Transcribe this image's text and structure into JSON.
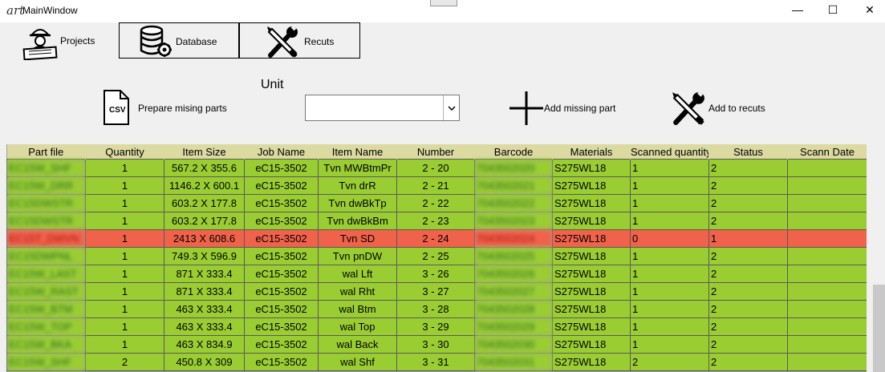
{
  "window": {
    "title": "MainWindow",
    "icon_text": "art",
    "minimize": "—",
    "maximize": "☐",
    "close": "✕"
  },
  "toolbar": {
    "projects": "Projects",
    "database": "Database",
    "recuts": "Recuts"
  },
  "actions": {
    "prepare": "Prepare mising parts",
    "csv": "CSV",
    "unit_label": "Unit",
    "add_missing": "Add missing part",
    "add_recuts": "Add to recuts"
  },
  "table": {
    "headers": [
      "Part file",
      "Quantity",
      "Item Size",
      "Job Name",
      "Item Name",
      "Number",
      "Barcode",
      "Materials",
      "Scanned quantity",
      "Status",
      "Scann Date"
    ],
    "rows": [
      {
        "part_file": "EC15W_SHF",
        "quantity": "1",
        "item_size": "567.2 X 355.6",
        "job_name": "eC15-3502",
        "item_name": "Tvn  MWBtmPr",
        "number": "2 - 20",
        "barcode": "7043502020",
        "materials": "S275WL18",
        "scanned": "1",
        "status": "2",
        "date": "",
        "state": "ok"
      },
      {
        "part_file": "EC15W_DRR",
        "quantity": "1",
        "item_size": "1146.2 X 600.1",
        "job_name": "eC15-3502",
        "item_name": "Tvn  drR",
        "number": "2 - 21",
        "barcode": "7043502021",
        "materials": "S275WL18",
        "scanned": "1",
        "status": "2",
        "date": "",
        "state": "ok"
      },
      {
        "part_file": "EC15DWSTR",
        "quantity": "1",
        "item_size": "603.2 X 177.8",
        "job_name": "eC15-3502",
        "item_name": "Tvn  dwBkTp",
        "number": "2 - 22",
        "barcode": "7043502022",
        "materials": "S275WL18",
        "scanned": "1",
        "status": "2",
        "date": "",
        "state": "ok"
      },
      {
        "part_file": "EC15DWSTR",
        "quantity": "1",
        "item_size": "603.2 X 177.8",
        "job_name": "eC15-3502",
        "item_name": "Tvn  dwBkBm",
        "number": "2 - 23",
        "barcode": "7043502023",
        "materials": "S275WL18",
        "scanned": "1",
        "status": "2",
        "date": "",
        "state": "ok"
      },
      {
        "part_file": "EC15T_DWVN",
        "quantity": "1",
        "item_size": "2413 X 608.6",
        "job_name": "eC15-3502",
        "item_name": "Tvn  SD",
        "number": "2 - 24",
        "barcode": "7043502024",
        "materials": "S275WL18",
        "scanned": "0",
        "status": "1",
        "date": "",
        "state": "missing"
      },
      {
        "part_file": "EC15DWPNL",
        "quantity": "1",
        "item_size": "749.3 X 596.9",
        "job_name": "eC15-3502",
        "item_name": "Tvn  pnDW",
        "number": "2 - 25",
        "barcode": "7043502025",
        "materials": "S275WL18",
        "scanned": "1",
        "status": "2",
        "date": "",
        "state": "ok"
      },
      {
        "part_file": "EC15W_LAST",
        "quantity": "1",
        "item_size": "871 X 333.4",
        "job_name": "eC15-3502",
        "item_name": "wal  Lft",
        "number": "3 - 26",
        "barcode": "7043502026",
        "materials": "S275WL18",
        "scanned": "1",
        "status": "2",
        "date": "",
        "state": "ok"
      },
      {
        "part_file": "EC15W_RAST",
        "quantity": "1",
        "item_size": "871 X 333.4",
        "job_name": "eC15-3502",
        "item_name": "wal  Rht",
        "number": "3 - 27",
        "barcode": "7043502027",
        "materials": "S275WL18",
        "scanned": "1",
        "status": "2",
        "date": "",
        "state": "ok"
      },
      {
        "part_file": "EC15W_BTM",
        "quantity": "1",
        "item_size": "463 X 333.4",
        "job_name": "eC15-3502",
        "item_name": "wal  Btm",
        "number": "3 - 28",
        "barcode": "7043502028",
        "materials": "S275WL18",
        "scanned": "1",
        "status": "2",
        "date": "",
        "state": "ok"
      },
      {
        "part_file": "EC15W_TOP",
        "quantity": "1",
        "item_size": "463 X 333.4",
        "job_name": "eC15-3502",
        "item_name": "wal  Top",
        "number": "3 - 29",
        "barcode": "7043502029",
        "materials": "S275WL18",
        "scanned": "1",
        "status": "2",
        "date": "",
        "state": "ok"
      },
      {
        "part_file": "EC15W_BKA",
        "quantity": "1",
        "item_size": "463 X 834.9",
        "job_name": "eC15-3502",
        "item_name": "wal  Back",
        "number": "3 - 30",
        "barcode": "7043502030",
        "materials": "S275WL18",
        "scanned": "1",
        "status": "2",
        "date": "",
        "state": "ok"
      },
      {
        "part_file": "EC15W_SHF",
        "quantity": "2",
        "item_size": "450.8 X 309",
        "job_name": "eC15-3502",
        "item_name": "wal  Shf",
        "number": "3 - 31",
        "barcode": "7043502031",
        "materials": "S275WL18",
        "scanned": "2",
        "status": "2",
        "date": "",
        "state": "ok"
      }
    ]
  }
}
